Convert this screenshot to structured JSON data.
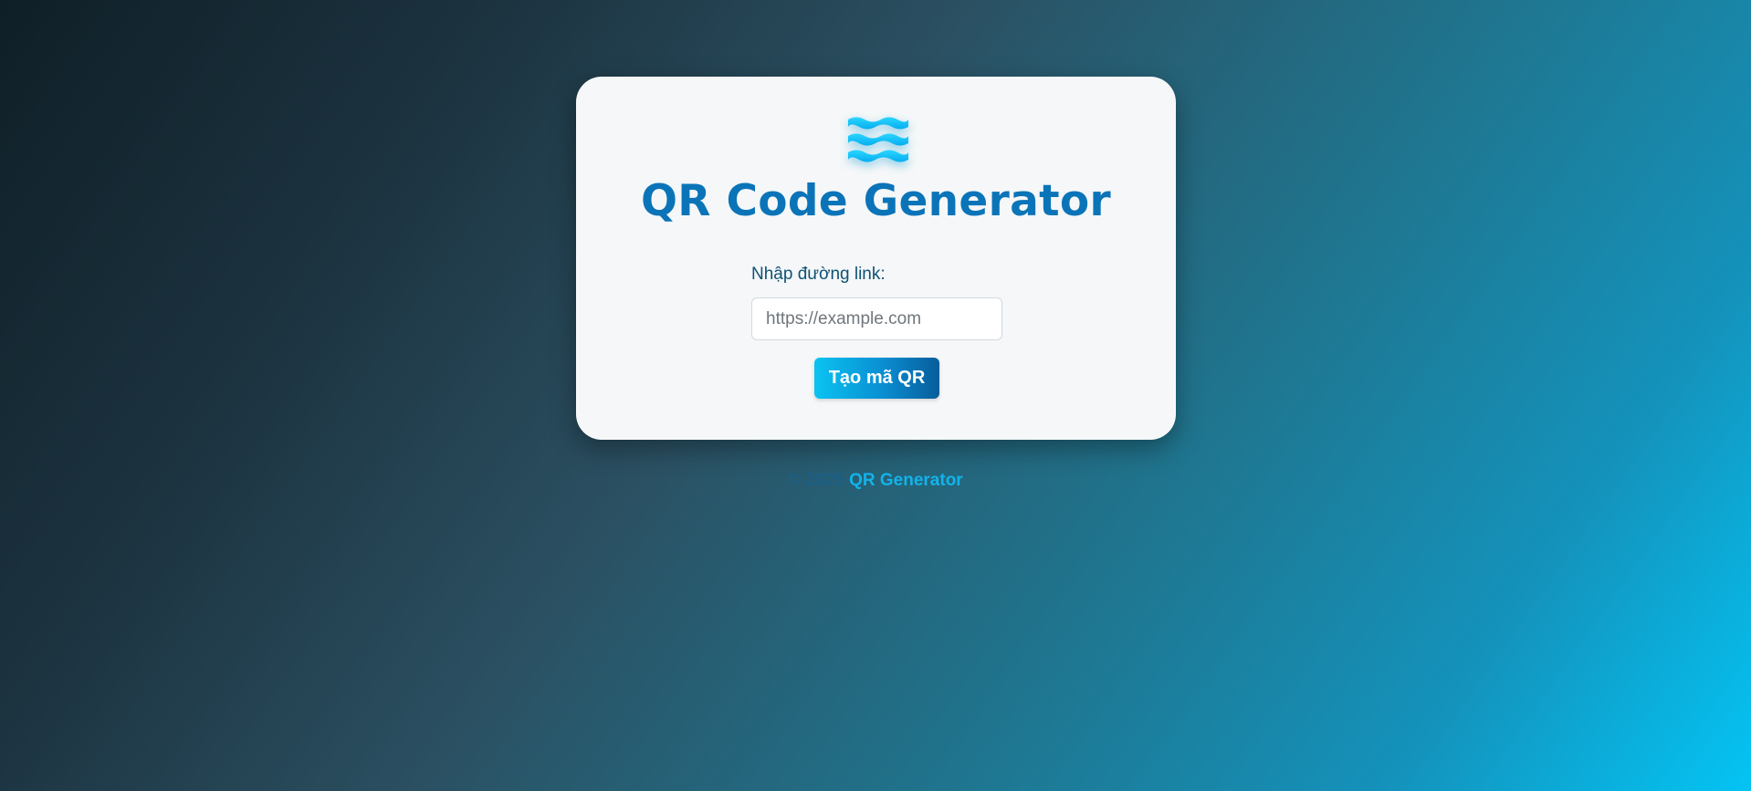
{
  "card": {
    "logo_icon": "waves-icon",
    "title": "QR Code Generator",
    "input_label": "Nhập đường link:",
    "input_placeholder": "https://example.com",
    "input_value": "",
    "button_label": "Tạo mã QR"
  },
  "footer": {
    "copyright": "© 2025",
    "brand": "QR Generator"
  },
  "colors": {
    "accent": "#0b74b8",
    "button_start": "#0bc3f1",
    "button_end": "#075d9a",
    "footer_brand": "#12b3ea"
  }
}
